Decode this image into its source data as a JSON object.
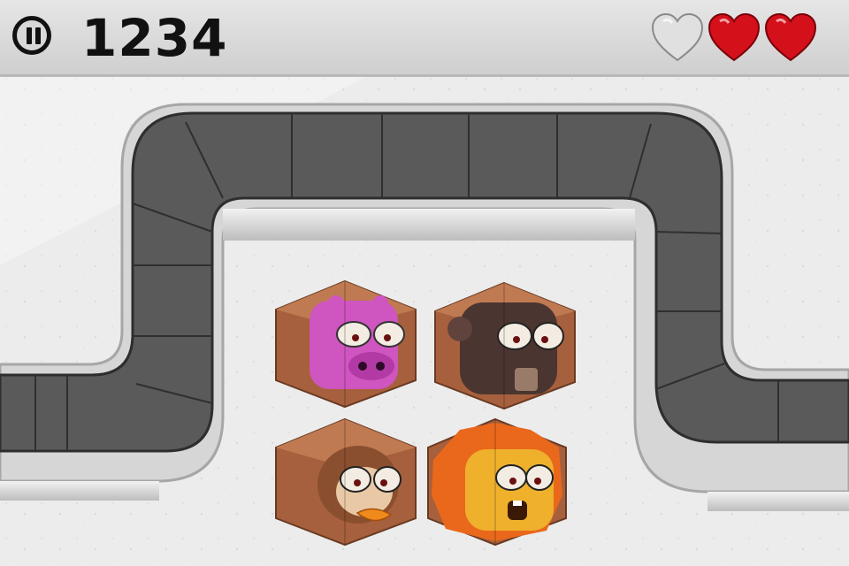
{
  "hud": {
    "score": "1234",
    "lives_total": 3,
    "lives_remaining": 2
  },
  "colors": {
    "heart_full": "#d4101a",
    "heart_empty": "#e0e0e0",
    "track": "#5c5c5c",
    "track_rim": "#d8d8d8",
    "floor": "#e9e9e9",
    "crate": "#a8603c"
  },
  "characters": [
    {
      "name": "hippo",
      "color": "#c447b5"
    },
    {
      "name": "gorilla",
      "color": "#4a3530"
    },
    {
      "name": "monkey",
      "color": "#8a4f2e"
    },
    {
      "name": "lion",
      "color": "#e8a22a"
    }
  ],
  "icons": [
    "pause-icon",
    "heart-icon"
  ]
}
